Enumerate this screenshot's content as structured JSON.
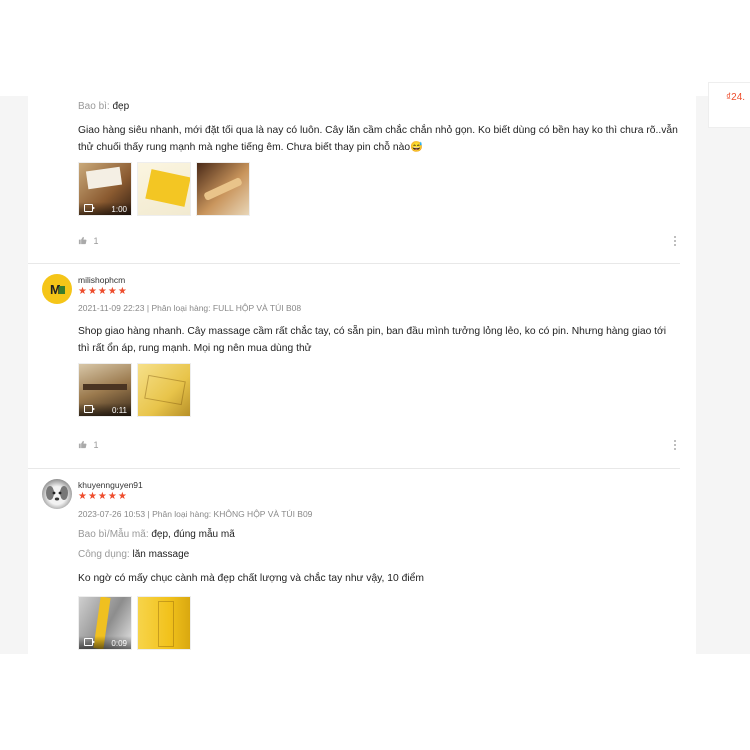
{
  "side": {
    "price": "₫24."
  },
  "reviews": [
    {
      "attr1_label": "Bao bì:",
      "attr1_value": "đẹp",
      "comment": "Giao hàng siêu nhanh, mới đặt tối qua là nay có luôn. Cây lăn cầm chắc chắn nhỏ gọn. Ko biết dùng có bền hay ko thì chưa rõ..vẫn thử chuối thấy rung mạnh mà nghe tiếng êm. Chưa biết thay pin chỗ nào😅",
      "video_duration": "1:00",
      "likes": "1"
    },
    {
      "username": "milishophcm",
      "stars": "★★★★★",
      "date": "2021-11-09 22:23",
      "variation_label": "Phân loại hàng:",
      "variation_value": "FULL HỘP VÀ TÚI B08",
      "comment": "Shop giao hàng nhanh. Cây massage cầm rất chắc tay, có sẵn pin, ban đầu mình tưởng lỏng lẻo, ko có pin. Nhưng hàng giao tới thì rất ổn áp, rung mạnh. Mọi ng nên mua dùng thử",
      "video_duration": "0:11",
      "likes": "1"
    },
    {
      "username": "khuyennguyen91",
      "stars": "★★★★★",
      "date": "2023-07-26 10:53",
      "variation_label": "Phân loại hàng:",
      "variation_value": "KHÔNG HỘP VÀ TÚI B09",
      "attr1_label": "Bao bì/Mẫu mã:",
      "attr1_value": "đẹp, đúng mẫu mã",
      "attr2_label": "Công dụng:",
      "attr2_value": "lăn massage",
      "comment": "Ko ngờ có mấy chục cành mà đẹp chất lượng và chắc tay như vậy, 10 điểm",
      "video_duration": "0:09"
    }
  ],
  "colors": {
    "accent": "#ee4d2d",
    "muted": "#888888",
    "box_yellow": "#f3c623"
  },
  "icons": [
    "video-icon",
    "thumbs-up-icon",
    "more-vertical-icon"
  ]
}
